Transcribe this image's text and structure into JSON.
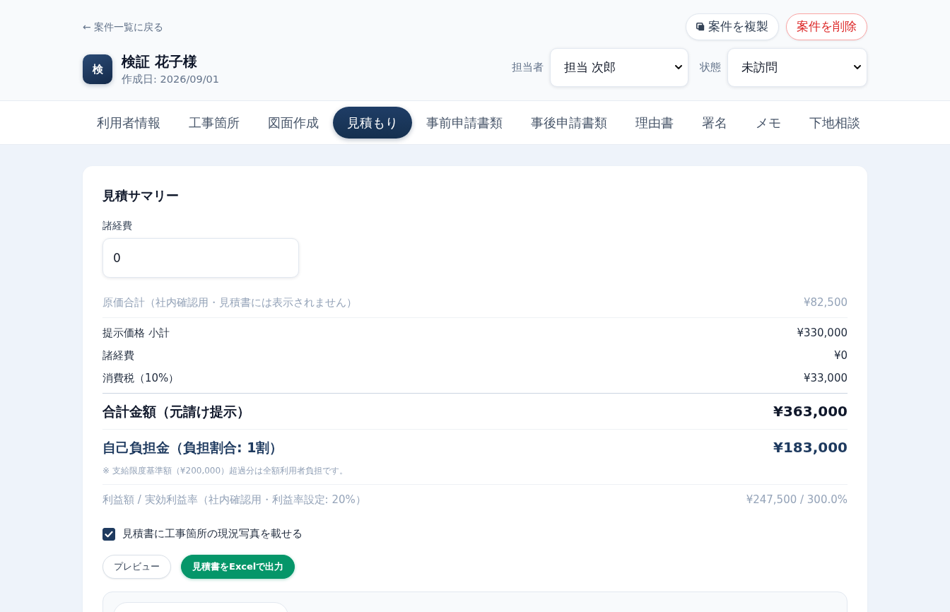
{
  "header": {
    "back_link": "← 案件一覧に戻る",
    "customer": {
      "avatar": "検",
      "name": "検証 花子様",
      "created": "作成日: 2026/09/01"
    },
    "actions": [
      {
        "kind": "copy",
        "label": "案件を複製"
      },
      {
        "kind": "danger",
        "label": "案件を削除"
      }
    ],
    "selects": [
      {
        "label": "担当者",
        "value": "担当 次郎"
      },
      {
        "label": "状態",
        "value": "未訪問"
      }
    ]
  },
  "tabs": [
    {
      "label": "利用者情報",
      "selected": false
    },
    {
      "label": "工事箇所",
      "selected": false
    },
    {
      "label": "図面作成",
      "selected": false
    },
    {
      "label": "見積もり",
      "selected": true
    },
    {
      "label": "事前申請書類",
      "selected": false
    },
    {
      "label": "事後申請書類",
      "selected": false
    },
    {
      "label": "理由書",
      "selected": false
    },
    {
      "label": "署名",
      "selected": false
    },
    {
      "label": "メモ",
      "selected": false
    },
    {
      "label": "下地相談",
      "selected": false
    }
  ],
  "summary": {
    "title": "見積サマリー",
    "expenses_field": {
      "label": "諸経費",
      "value": "0"
    },
    "rows": [
      {
        "kind": "internal",
        "label": "原価合計（社内確認用・見積書には表示されません）",
        "value": "¥82,500"
      },
      {
        "kind": "line",
        "label": "提示価格 小計",
        "value": "¥330,000"
      },
      {
        "kind": "line",
        "label": "諸経費",
        "value": "¥0"
      },
      {
        "kind": "line",
        "label": "消費税（10%）",
        "value": "¥33,000"
      },
      {
        "kind": "total",
        "label": "合計金額（元請け提示）",
        "value": "¥363,000"
      },
      {
        "kind": "copay",
        "label": "自己負担金（負担割合: 1割）",
        "value": "¥183,000",
        "note": "※ 支給限度基準額（¥200,000）超過分は全額利用者負担です。"
      },
      {
        "kind": "internal",
        "label": "利益額 / 実効利益率（社内確認用・利益率設定: 20%）",
        "value": "¥247,500 / 300.0%"
      }
    ],
    "photo_option": {
      "label": "見積書に工事箇所の現況写真を載せる",
      "checked": true
    },
    "buttons": [
      {
        "kind": "secondary",
        "label": "プレビュー"
      },
      {
        "kind": "excel",
        "label": "見積書をExcelで出力"
      }
    ]
  }
}
